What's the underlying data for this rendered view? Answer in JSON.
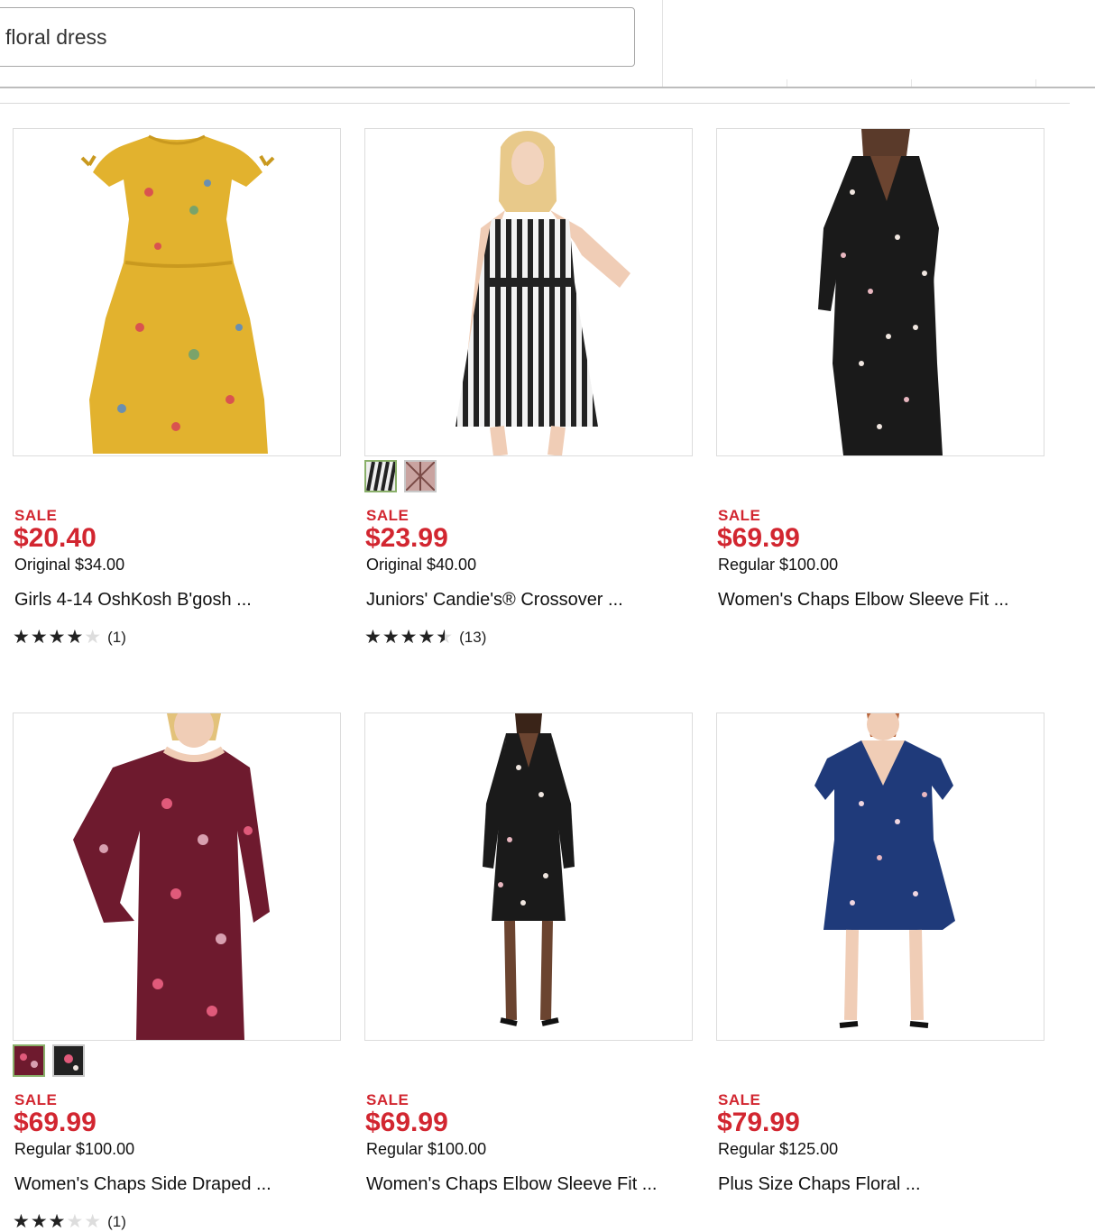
{
  "search": {
    "value": "floral dress"
  },
  "products": [
    {
      "sale_label": "SALE",
      "price": "$20.40",
      "original": "Original $34.00",
      "title": "Girls 4-14 OshKosh B'gosh ...",
      "rating": 4,
      "reviews": "(1)",
      "image": "yellow-floral-dress"
    },
    {
      "sale_label": "SALE",
      "price": "$23.99",
      "original": "Original $40.00",
      "title": "Juniors' Candie's® Crossover ...",
      "rating": 4.5,
      "reviews": "(13)",
      "image": "striped-dress",
      "swatches": [
        "black-white-stripe",
        "pink-print"
      ]
    },
    {
      "sale_label": "SALE",
      "price": "$69.99",
      "original": "Regular $100.00",
      "title": "Women's Chaps Elbow Sleeve Fit ...",
      "image": "black-floral-dress"
    },
    {
      "sale_label": "SALE",
      "price": "$69.99",
      "original": "Regular $100.00",
      "title": "Women's Chaps Side Draped ...",
      "rating": 3,
      "reviews": "(1)",
      "image": "burgundy-floral-dress",
      "swatches": [
        "burgundy-floral",
        "black-floral"
      ]
    },
    {
      "sale_label": "SALE",
      "price": "$69.99",
      "original": "Regular $100.00",
      "title": "Women's Chaps Elbow Sleeve Fit ...",
      "image": "black-floral-dress-model"
    },
    {
      "sale_label": "SALE",
      "price": "$79.99",
      "original": "Regular $125.00",
      "title": "Plus Size Chaps Floral ...",
      "image": "navy-floral-wrap-dress"
    }
  ],
  "theme": {
    "sale_color": "#d22630",
    "border": "#dcdcdc",
    "selected_swatch": "#8ab06a"
  }
}
